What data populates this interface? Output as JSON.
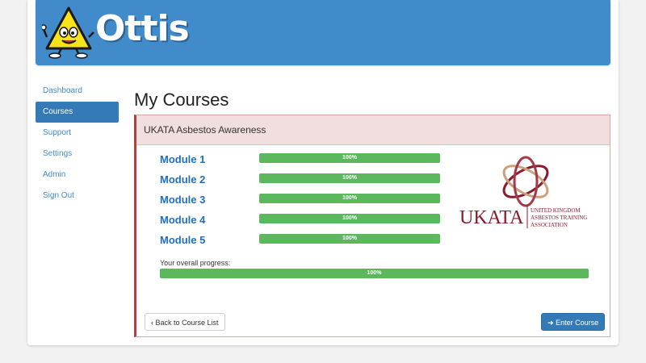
{
  "brand": {
    "name": "Ottis"
  },
  "nav": {
    "items": [
      {
        "label": "Dashboard",
        "active": false
      },
      {
        "label": "Courses",
        "active": true
      },
      {
        "label": "Support",
        "active": false
      },
      {
        "label": "Settings",
        "active": false
      },
      {
        "label": "Admin",
        "active": false
      },
      {
        "label": "Sign Out",
        "active": false
      }
    ]
  },
  "page": {
    "title": "My Courses"
  },
  "course": {
    "title": "UKATA Asbestos Awareness",
    "modules": [
      {
        "name": "Module 1",
        "progress": 100,
        "progress_label": "100%"
      },
      {
        "name": "Module 2",
        "progress": 100,
        "progress_label": "100%"
      },
      {
        "name": "Module 3",
        "progress": 100,
        "progress_label": "100%"
      },
      {
        "name": "Module 4",
        "progress": 100,
        "progress_label": "100%"
      },
      {
        "name": "Module 5",
        "progress": 100,
        "progress_label": "100%"
      }
    ],
    "overall_label": "Your overall progress:",
    "overall_progress": 100,
    "overall_progress_label": "100%",
    "logo": {
      "wordmark": "UKATA",
      "line1": "UNITED KINGDOM",
      "line2": "ASBESTOS TRAINING",
      "line3": "ASSOCIATION"
    }
  },
  "actions": {
    "back_label": "‹ Back to Course List",
    "enter_label": "Enter Course",
    "enter_icon": "circle-arrow-icon"
  },
  "colors": {
    "header": "#428bca",
    "nav_active": "#337ab7",
    "progress": "#5cb85c",
    "panel_accent": "#a94442",
    "panel_heading_bg": "#f2dede",
    "ukata_red": "#8b1a2b"
  }
}
